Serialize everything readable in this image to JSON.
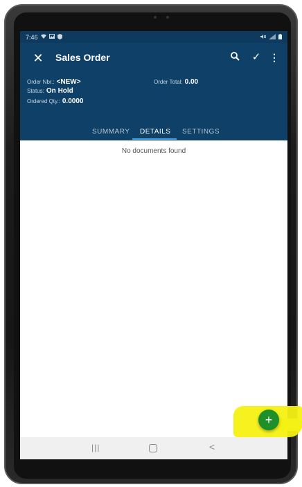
{
  "status_bar": {
    "time": "7:46",
    "left_icons": [
      "wifi-icon",
      "image-icon",
      "shield-icon"
    ],
    "right_icons": [
      "mute-icon",
      "signal-icon",
      "battery-icon"
    ]
  },
  "app_bar": {
    "title": "Sales Order",
    "close_icon": "✕",
    "search_icon": "search-icon",
    "check_icon": "✓",
    "more_icon": "⋮"
  },
  "order_info": {
    "order_nbr_label": "Order Nbr.:",
    "order_nbr_value": "<NEW>",
    "status_label": "Status:",
    "status_value": "On Hold",
    "ordered_qty_label": "Ordered Qty.:",
    "ordered_qty_value": "0.0000",
    "order_total_label": "Order Total:",
    "order_total_value": "0.00"
  },
  "tabs": [
    {
      "label": "SUMMARY",
      "active": false
    },
    {
      "label": "DETAILS",
      "active": true
    },
    {
      "label": "SETTINGS",
      "active": false
    }
  ],
  "content": {
    "empty_message": "No documents found"
  },
  "fab": {
    "label": "+"
  },
  "nav_bar": {
    "recent": "|||",
    "back": "<"
  },
  "colors": {
    "app_bar": "#0f4067",
    "status_bar": "#0f3a5f",
    "fab": "#1f8f2a",
    "highlight": "#f4f114",
    "tab_indicator": "#4ba3e3"
  }
}
